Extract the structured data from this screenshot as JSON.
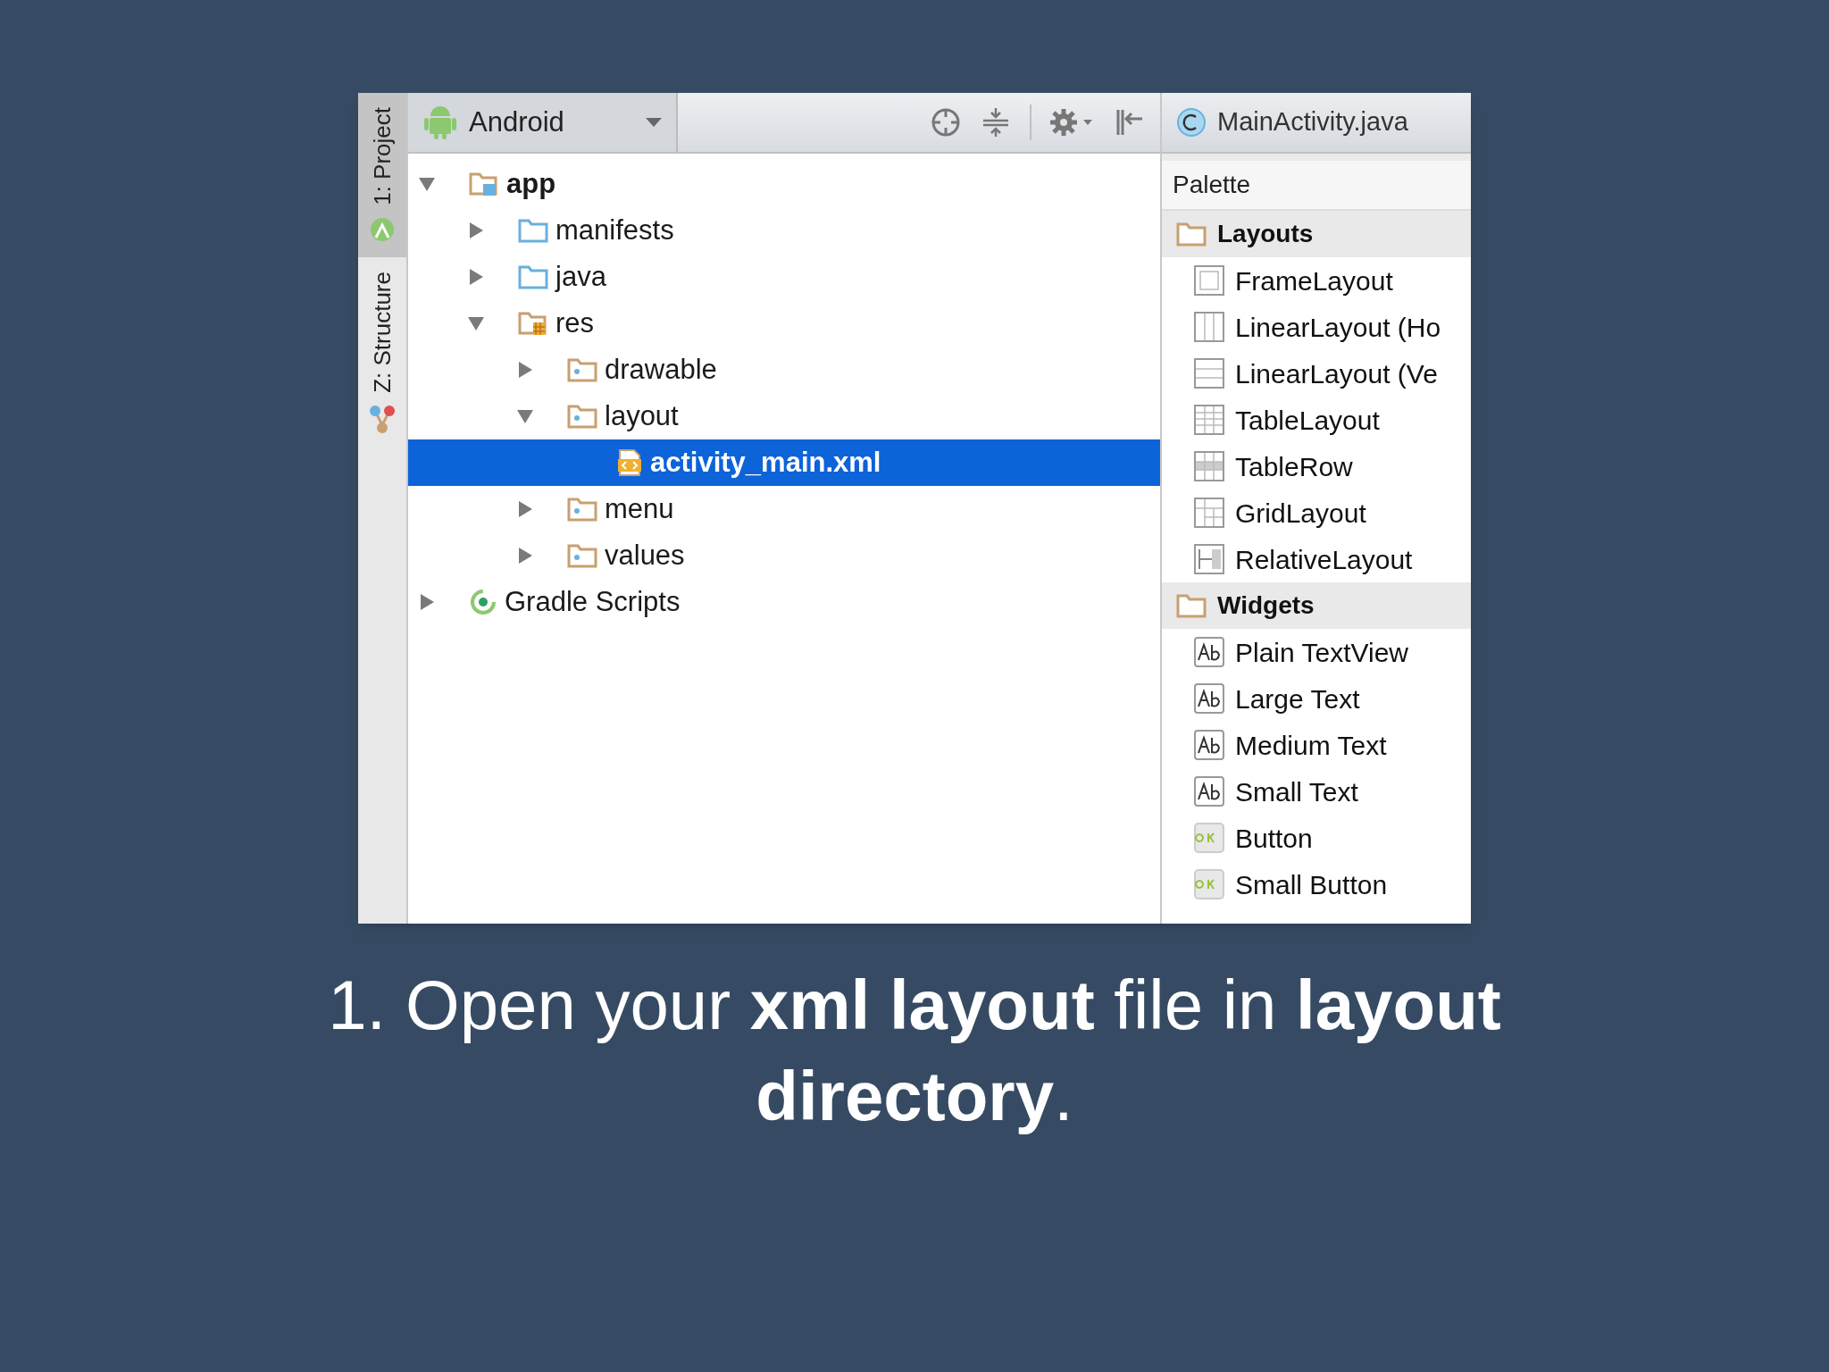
{
  "side_tabs": [
    {
      "label": "1: Project",
      "kind": "project",
      "selected": true
    },
    {
      "label": "Z: Structure",
      "kind": "structure",
      "selected": false
    }
  ],
  "view_selector": {
    "label": "Android"
  },
  "tree": [
    {
      "label": "app",
      "kind": "module",
      "bold": true,
      "expanded": true,
      "selected": false,
      "children": [
        {
          "label": "manifests",
          "kind": "source-folder",
          "expanded": false,
          "selected": false
        },
        {
          "label": "java",
          "kind": "source-folder",
          "expanded": false,
          "selected": false
        },
        {
          "label": "res",
          "kind": "res-folder",
          "expanded": true,
          "selected": false,
          "children": [
            {
              "label": "drawable",
              "kind": "folder",
              "expanded": false,
              "selected": false
            },
            {
              "label": "layout",
              "kind": "folder",
              "expanded": true,
              "selected": false,
              "children": [
                {
                  "label": "activity_main.xml",
                  "kind": "xml-file",
                  "selected": true
                }
              ]
            },
            {
              "label": "menu",
              "kind": "folder",
              "expanded": false,
              "selected": false
            },
            {
              "label": "values",
              "kind": "folder",
              "expanded": false,
              "selected": false
            }
          ]
        }
      ]
    },
    {
      "label": "Gradle Scripts",
      "kind": "gradle",
      "bold": false,
      "expanded": false,
      "selected": false
    }
  ],
  "editor_tab": {
    "label": "MainActivity.java"
  },
  "palette": {
    "title": "Palette",
    "sections": [
      {
        "title": "Layouts",
        "items": [
          {
            "label": "FrameLayout",
            "kind": "frame"
          },
          {
            "label": "LinearLayout (Ho",
            "kind": "linear-h"
          },
          {
            "label": "LinearLayout (Ve",
            "kind": "linear-v"
          },
          {
            "label": "TableLayout",
            "kind": "table"
          },
          {
            "label": "TableRow",
            "kind": "table-row"
          },
          {
            "label": "GridLayout",
            "kind": "grid"
          },
          {
            "label": "RelativeLayout",
            "kind": "relative"
          }
        ]
      },
      {
        "title": "Widgets",
        "items": [
          {
            "label": "Plain TextView",
            "kind": "text"
          },
          {
            "label": "Large Text",
            "kind": "text"
          },
          {
            "label": "Medium Text",
            "kind": "text"
          },
          {
            "label": "Small Text",
            "kind": "text"
          },
          {
            "label": "Button",
            "kind": "button"
          },
          {
            "label": "Small Button",
            "kind": "button"
          }
        ]
      }
    ]
  },
  "caption": "1. Open your **xml layout** file in **layout directory**."
}
